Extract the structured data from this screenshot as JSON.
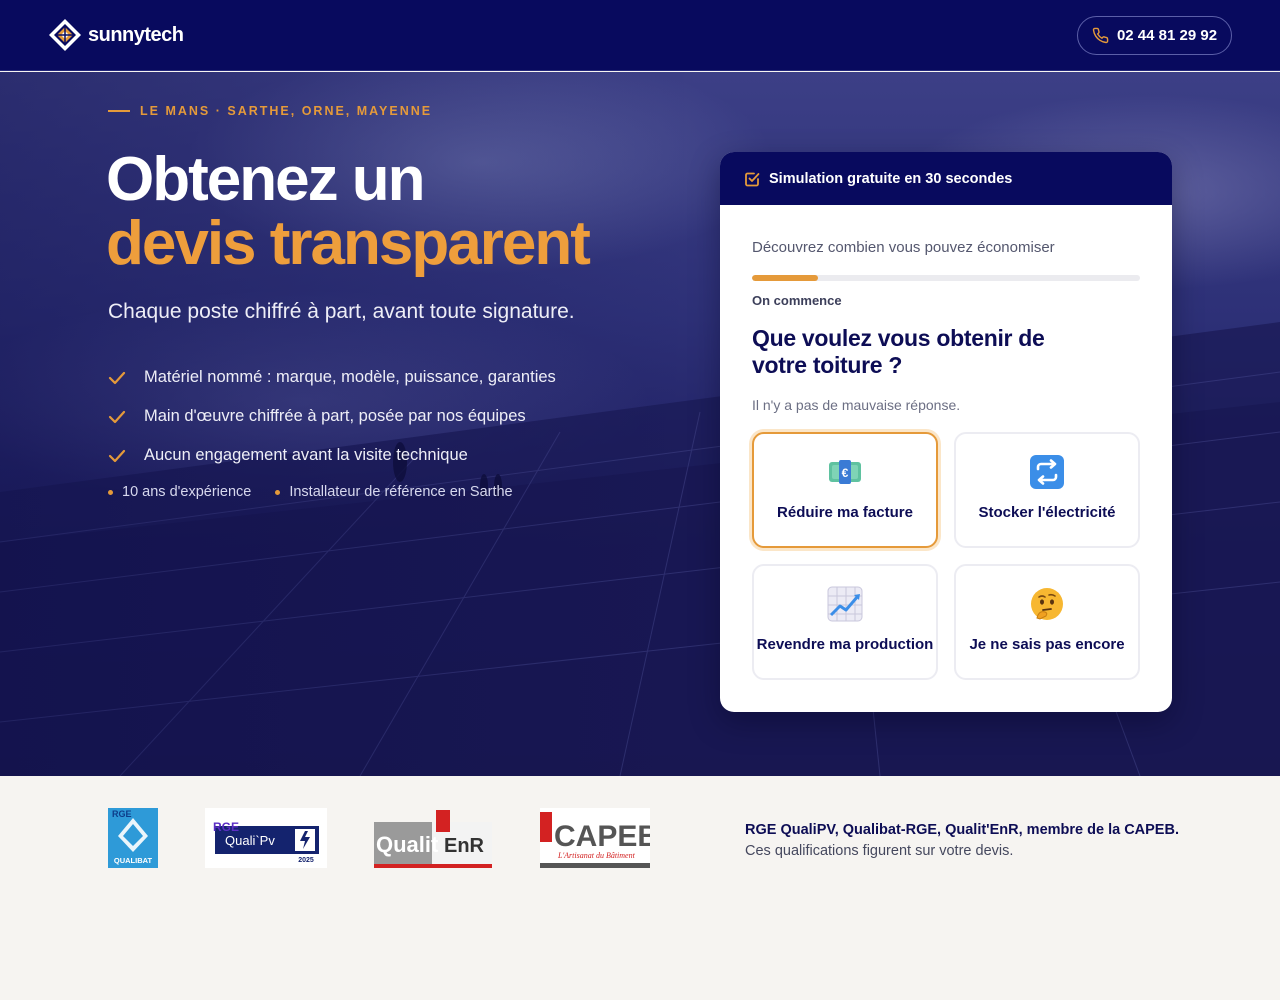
{
  "header": {
    "brand": "sunnytech",
    "phone": "02 44 81 29 92"
  },
  "hero": {
    "eyebrow": "LE MANS · SARTHE, ORNE, MAYENNE",
    "title_line1": "Obtenez un",
    "title_line2": "devis transparent",
    "subtitle": "Chaque poste chiffré à part, avant toute signature.",
    "bullets": [
      "Matériel nommé : marque, modèle, puissance, garanties",
      "Main d'œuvre chiffrée à part, posée par nos équipes",
      "Aucun engagement avant la visite technique"
    ],
    "meta": [
      "10 ans d'expérience",
      "Installateur de référence en Sarthe"
    ]
  },
  "card": {
    "header": "Simulation gratuite en 30 secondes",
    "discover": "Découvrez combien vous pouvez économiser",
    "progress": 0.17,
    "step": "On commence",
    "question": "Que voulez vous obtenir de votre toiture ?",
    "hint": "Il n'y a pas de mauvaise réponse.",
    "options": [
      {
        "label": "Réduire ma facture",
        "icon": "money-icon",
        "selected": true
      },
      {
        "label": "Stocker l'électricité",
        "icon": "repeat-icon",
        "selected": false
      },
      {
        "label": "Revendre ma production",
        "icon": "chart-increasing-icon",
        "selected": false
      },
      {
        "label": "Je ne sais pas encore",
        "icon": "thinking-face-icon",
        "selected": false
      }
    ]
  },
  "certifications": {
    "badges": [
      {
        "name": "Qualibat RGE",
        "top": "RGE",
        "bottom": "QUALIBAT"
      },
      {
        "name": "QualiPV RGE",
        "top": "RGE",
        "label": "Quali`Pv",
        "year": "2025"
      },
      {
        "name": "Qualit'EnR",
        "label": "Qualit",
        "label2": "EnR"
      },
      {
        "name": "CAPEB",
        "label": "CAPEB",
        "tagline": "L'Artisanat du Bâtiment"
      }
    ],
    "strong": "RGE QualiPV, Qualibat-RGE, Qualit'EnR, membre de la CAPEB.",
    "light": "Ces qualifications figurent sur votre devis."
  },
  "colors": {
    "navy": "#080a5e",
    "accent": "#e59a3a",
    "background": "#f6f4f1"
  }
}
